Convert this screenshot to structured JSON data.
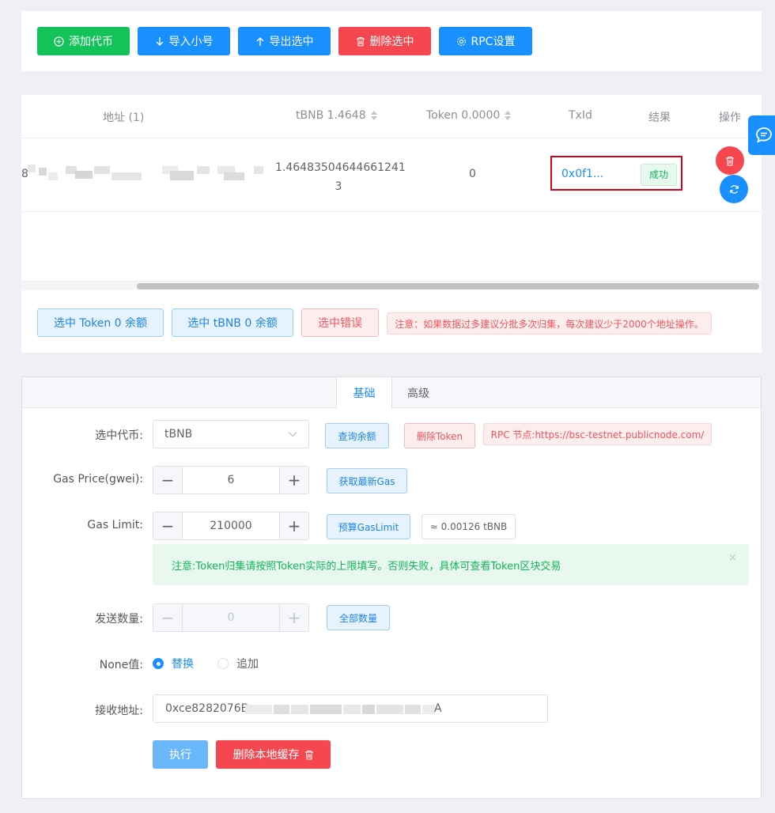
{
  "toolbar": {
    "add_token": "添加代币",
    "import_sub": "导入小号",
    "export_selected": "导出选中",
    "delete_selected": "删除选中",
    "rpc_settings": "RPC设置"
  },
  "table": {
    "columns": {
      "address": "地址 (1)",
      "tbnb": "tBNB 1.4648",
      "token": "Token 0.0000",
      "txid": "TxId",
      "result": "结果",
      "action": "操作"
    },
    "rows": [
      {
        "address_prefix": "8",
        "tbnb_line1": "1.46483504644661241",
        "tbnb_line2": "3",
        "token": "0",
        "txid": "0x0f1...",
        "result": "成功"
      }
    ]
  },
  "filters": {
    "select_token_zero": "选中 Token 0 余额",
    "select_tbnb_zero": "选中 tBNB 0 余额",
    "select_error": "选中错误",
    "notice": "注意：如果数据过多建议分批多次归集，每次建议少于2000个地址操作。"
  },
  "tabs": [
    "基础",
    "高级"
  ],
  "form": {
    "token_label": "选中代币:",
    "token_value": "tBNB",
    "query_balance": "查询余额",
    "delete_token": "删除Token",
    "rpc_node": "RPC 节点:https://bsc-testnet.publicnode.com/",
    "gas_price_label": "Gas Price(gwei):",
    "gas_price_value": "6",
    "fetch_gas": "获取最新Gas",
    "gas_limit_label": "Gas Limit:",
    "gas_limit_value": "210000",
    "estimate_gas": "预算GasLimit",
    "gas_estimate": "≈ 0.00126 tBNB",
    "alert": "注意:Token归集请按照Token实际的上限填写。否则失败，具体可查看Token区块交易",
    "amount_label": "发送数量:",
    "amount_value": "0",
    "all_amount": "全部数量",
    "nonce_label": "None值:",
    "radio_replace": "替换",
    "radio_append": "追加",
    "receiver_label": "接收地址:",
    "receiver_prefix": "0xce8282076E",
    "receiver_suffix": "A",
    "execute": "执行",
    "clear_cache": "删除本地缓存"
  },
  "colors": {
    "primary": "#1890ff",
    "success": "#13c35a",
    "danger": "#f5474f"
  }
}
